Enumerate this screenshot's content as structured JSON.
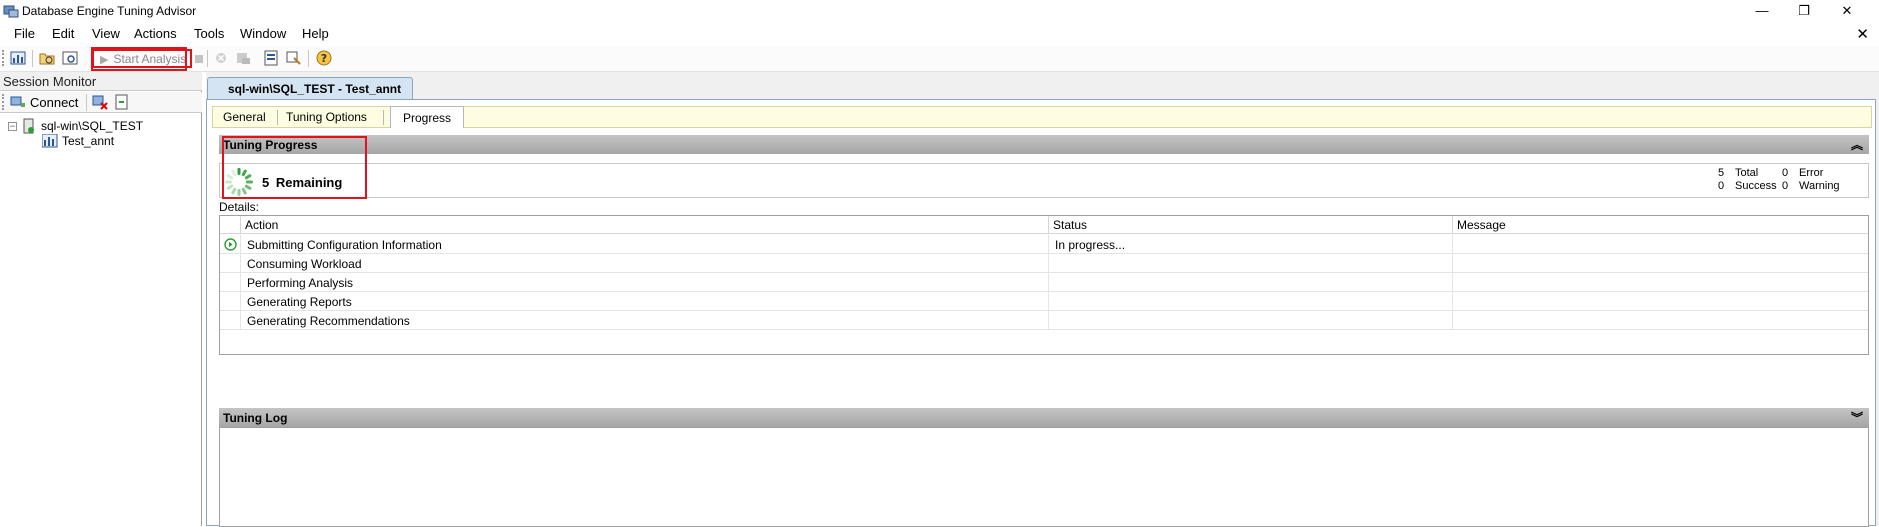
{
  "window": {
    "title": "Database Engine Tuning Advisor",
    "minimize_glyph": "—",
    "restore_glyph": "❐",
    "close_glyph": "✕"
  },
  "menu": {
    "items": [
      "File",
      "Edit",
      "View",
      "Actions",
      "Tools",
      "Window",
      "Help"
    ],
    "close_glyph": "✕"
  },
  "toolbar": {
    "start_analysis_label": "Start Analysis",
    "icons": [
      "new-session-icon",
      "open-file-icon",
      "preview-icon",
      "play-icon",
      "stop-icon",
      "cancel-icon",
      "save-recommendation-icon",
      "session-properties-icon",
      "evaluate-icon",
      "help-icon"
    ]
  },
  "session_monitor": {
    "title": "Session Monitor",
    "connect_label": "Connect",
    "tree": {
      "server": "sql-win\\SQL_TEST",
      "sessions": [
        "Test_annt"
      ]
    }
  },
  "document": {
    "tab_title": "sql-win\\SQL_TEST - Test_annt",
    "inner_tabs": [
      "General",
      "Tuning Options",
      "Progress"
    ],
    "active_tab": "Progress"
  },
  "tuning_progress": {
    "header": "Tuning Progress",
    "remaining_count": "5",
    "remaining_label": "Remaining",
    "stats": {
      "total_value": "5",
      "total_label": "Total",
      "error_value": "0",
      "error_label": "Error",
      "success_value": "0",
      "success_label": "Success",
      "warning_value": "0",
      "warning_label": "Warning"
    },
    "details_label": "Details:",
    "columns": [
      "Action",
      "Status",
      "Message"
    ],
    "rows": [
      {
        "action": "Submitting Configuration Information",
        "status": "In progress...",
        "message": ""
      },
      {
        "action": "Consuming Workload",
        "status": "",
        "message": ""
      },
      {
        "action": "Performing Analysis",
        "status": "",
        "message": ""
      },
      {
        "action": "Generating Reports",
        "status": "",
        "message": ""
      },
      {
        "action": "Generating Recommendations",
        "status": "",
        "message": ""
      }
    ]
  },
  "tuning_log": {
    "header": "Tuning Log"
  },
  "colors": {
    "highlight_red": "#e0131b",
    "spinner_green": "#2e9e3a",
    "tab_blue": "#d5e4f2",
    "inner_tab_yellow": "#fffde1"
  }
}
